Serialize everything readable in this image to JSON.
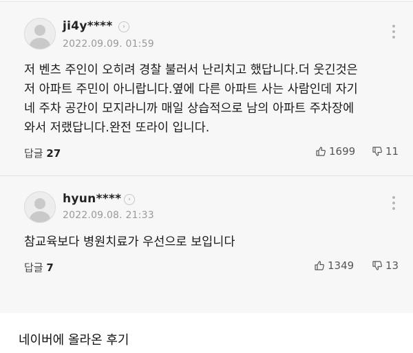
{
  "comments": [
    {
      "username": "ji4y****",
      "timestamp": "2022.09.09. 01:59",
      "text_lines": [
        "저 벤츠 주인이 오히려 경찰 불러서 난리치고 했답니다.더 웃긴것은",
        "저 아파트 주민이 아니랍니다.옆에 다른 아파트 사는 사람인데 자기",
        "네 주차 공간이 모지라니까 매일 상습적으로 남의 아파트 주차장에",
        "와서 저랬답니다.완전 또라이 입니다."
      ],
      "reply_label": "답글",
      "reply_count": "27",
      "like_count": "1699",
      "dislike_count": "11"
    },
    {
      "username": "hyun****",
      "timestamp": "2022.09.08. 21:33",
      "text_lines": [
        "참교육보다 병원치료가 우선으로 보입니다"
      ],
      "reply_label": "답글",
      "reply_count": "7",
      "like_count": "1349",
      "dislike_count": "13"
    }
  ],
  "caption": "네이버에 올라온 후기",
  "icons": {
    "avatar": "default-avatar-icon",
    "profile": "chevron-right-icon",
    "more": "more-vertical-icon",
    "like": "thumbs-up-icon",
    "dislike": "thumbs-down-icon"
  },
  "colors": {
    "screenshot_background": "#f7f7f7",
    "text": "#1a1a1a",
    "meta": "#999999"
  }
}
